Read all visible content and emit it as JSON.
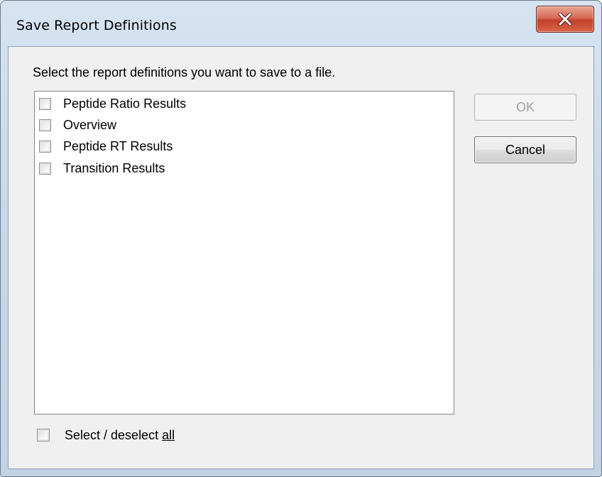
{
  "window": {
    "title": "Save Report Definitions"
  },
  "icons": {
    "close": "close-x-icon"
  },
  "instruction": "Select the report definitions you want to save to a file.",
  "report_list": {
    "items": [
      {
        "label": "Peptide Ratio Results",
        "checked": false
      },
      {
        "label": "Overview",
        "checked": false
      },
      {
        "label": "Peptide RT Results",
        "checked": false
      },
      {
        "label": "Transition Results",
        "checked": false
      }
    ]
  },
  "buttons": {
    "ok_label": "OK",
    "ok_enabled": false,
    "cancel_label": "Cancel"
  },
  "select_all": {
    "label_prefix": "Select / deselect ",
    "label_mnemonic": "all",
    "checked": false
  },
  "colors": {
    "close_button": "#c94a33",
    "frame": "#c9d9ea",
    "disabled_text": "#a0a0a0"
  }
}
